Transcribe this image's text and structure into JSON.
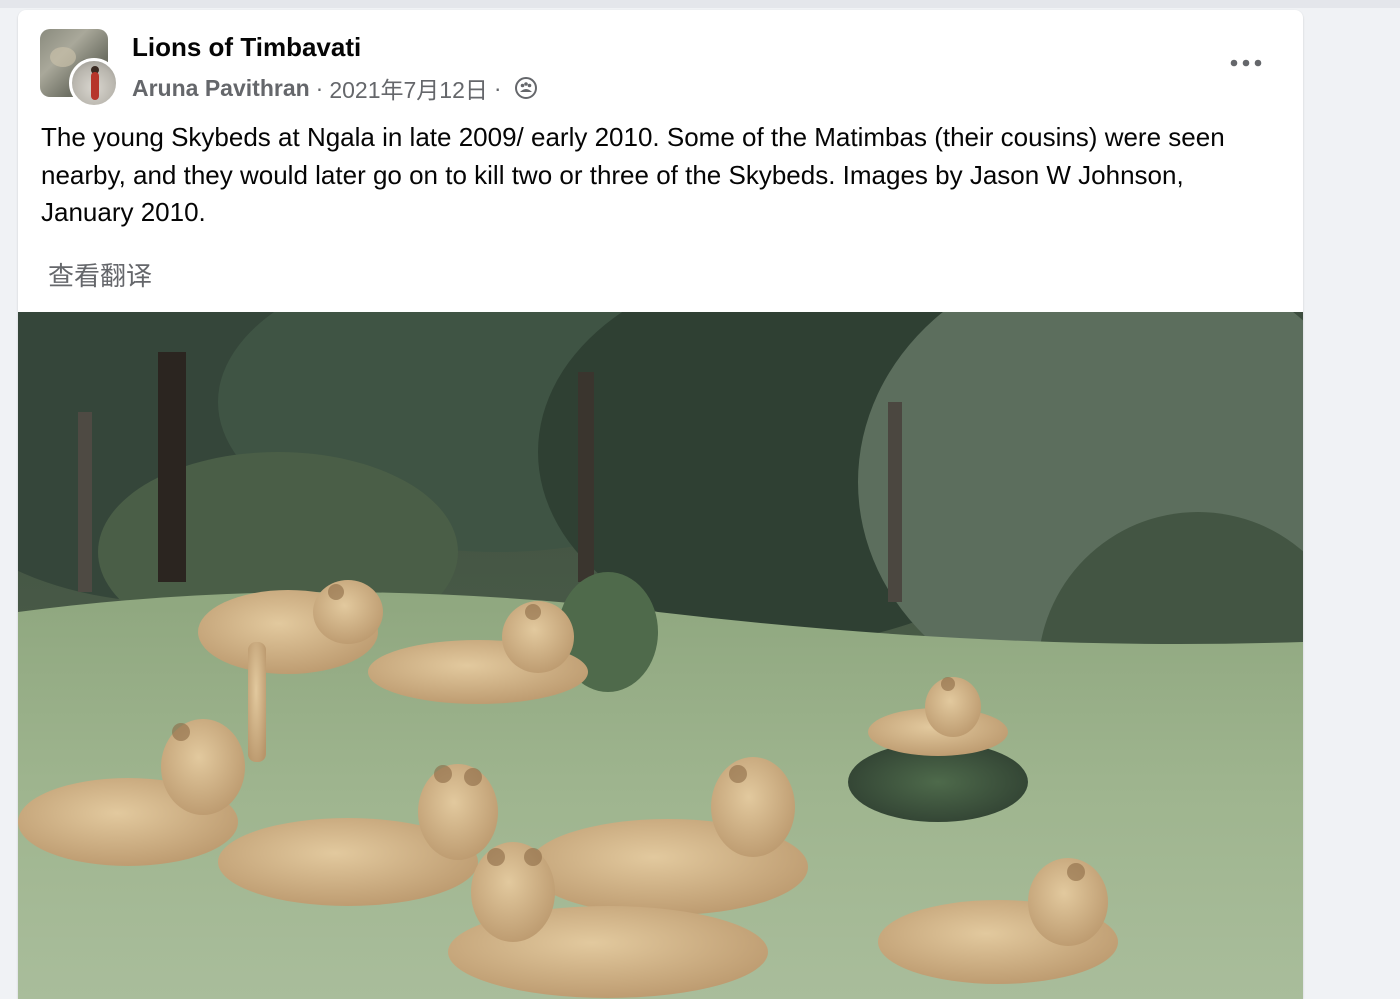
{
  "post": {
    "page_name": "Lions of Timbavati",
    "author": "Aruna Pavithran",
    "separator": "·",
    "date": "2021年7月12日",
    "privacy_icon": "group-members-icon",
    "more_icon": "more-dots-icon",
    "text": "The young Skybeds at Ngala in late 2009/ early 2010. Some of the Matimbas (their cousins) were seen nearby, and they would later go on to kill two or three of the Skybeds. Images by Jason W Johnson, January 2010.",
    "translate_label": "查看翻译",
    "photo": {
      "subject": "pride of young lions resting in grassy clearing"
    }
  }
}
